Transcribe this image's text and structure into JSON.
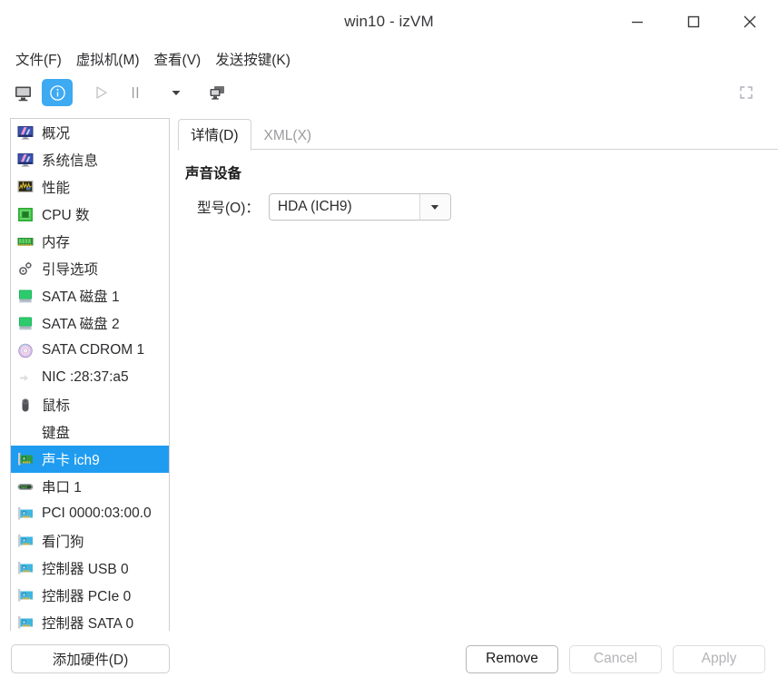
{
  "window": {
    "title": "win10 - izVM",
    "controls": [
      {
        "name": "minimize",
        "glyph": "minimize-icon"
      },
      {
        "name": "maximize",
        "glyph": "maximize-icon"
      },
      {
        "name": "close",
        "glyph": "close-icon"
      }
    ]
  },
  "menubar": {
    "items": [
      {
        "label": "文件(F)",
        "name": "menu-file"
      },
      {
        "label": "虚拟机(M)",
        "name": "menu-virtual-machine"
      },
      {
        "label": "查看(V)",
        "name": "menu-view"
      },
      {
        "label": "发送按键(K)",
        "name": "menu-send-key"
      }
    ]
  },
  "toolbar": {
    "buttons": [
      {
        "name": "console-view-button",
        "icon": "monitor-icon",
        "active": false
      },
      {
        "name": "details-view-button",
        "icon": "info-icon",
        "active": true
      },
      {
        "name": "run-button",
        "icon": "play-icon",
        "active": false
      },
      {
        "name": "pause-button",
        "icon": "pause-icon",
        "active": false
      },
      {
        "name": "shutdown-dropdown-button",
        "icon": "chevron-down-icon",
        "active": false
      },
      {
        "name": "snapshot-button",
        "icon": "clone-icon",
        "active": false
      }
    ],
    "fullscreen": {
      "name": "fullscreen-button",
      "icon": "fullscreen-icon"
    }
  },
  "sidebar": {
    "items": [
      {
        "label": "概况",
        "icon": "overview-icon",
        "selected": false
      },
      {
        "label": "系统信息",
        "icon": "overview-icon",
        "selected": false
      },
      {
        "label": "性能",
        "icon": "performance-icon",
        "selected": false
      },
      {
        "label": "CPU 数",
        "icon": "cpu-icon",
        "selected": false
      },
      {
        "label": "内存",
        "icon": "memory-icon",
        "selected": false
      },
      {
        "label": "引导选项",
        "icon": "boot-options-icon",
        "selected": false
      },
      {
        "label": "SATA 磁盘 1",
        "icon": "disk-icon",
        "selected": false
      },
      {
        "label": "SATA 磁盘 2",
        "icon": "disk-icon",
        "selected": false
      },
      {
        "label": "SATA CDROM 1",
        "icon": "cdrom-icon",
        "selected": false
      },
      {
        "label": "NIC :28:37:a5",
        "icon": "network-icon",
        "selected": false
      },
      {
        "label": "鼠标",
        "icon": "mouse-icon",
        "selected": false
      },
      {
        "label": "键盘",
        "icon": "none-icon",
        "selected": false
      },
      {
        "label": "声卡 ich9",
        "icon": "pci-card-green-icon",
        "selected": true
      },
      {
        "label": "串口 1",
        "icon": "serial-port-icon",
        "selected": false
      },
      {
        "label": "PCI 0000:03:00.0",
        "icon": "pci-card-icon",
        "selected": false
      },
      {
        "label": "看门狗",
        "icon": "pci-card-icon",
        "selected": false
      },
      {
        "label": "控制器 USB 0",
        "icon": "pci-card-icon",
        "selected": false
      },
      {
        "label": "控制器 PCIe 0",
        "icon": "pci-card-icon",
        "selected": false
      },
      {
        "label": "控制器 SATA 0",
        "icon": "pci-card-icon",
        "selected": false
      }
    ],
    "add_hardware_label": "添加硬件(D)"
  },
  "main": {
    "tabs": [
      {
        "label": "详情(D)",
        "name": "tab-details",
        "active": true
      },
      {
        "label": "XML(X)",
        "name": "tab-xml",
        "active": false
      }
    ],
    "section_title": "声音设备",
    "model_label": "型号(O)：",
    "model_value": "HDA (ICH9)"
  },
  "footer": {
    "remove_label": "Remove",
    "cancel_label": "Cancel",
    "apply_label": "Apply"
  },
  "colors": {
    "accent": "#1f9cf0",
    "toolbar_active": "#3daaf2",
    "border": "#cfcfcf",
    "text": "#2c2c2f",
    "muted": "#9b9b9f"
  }
}
